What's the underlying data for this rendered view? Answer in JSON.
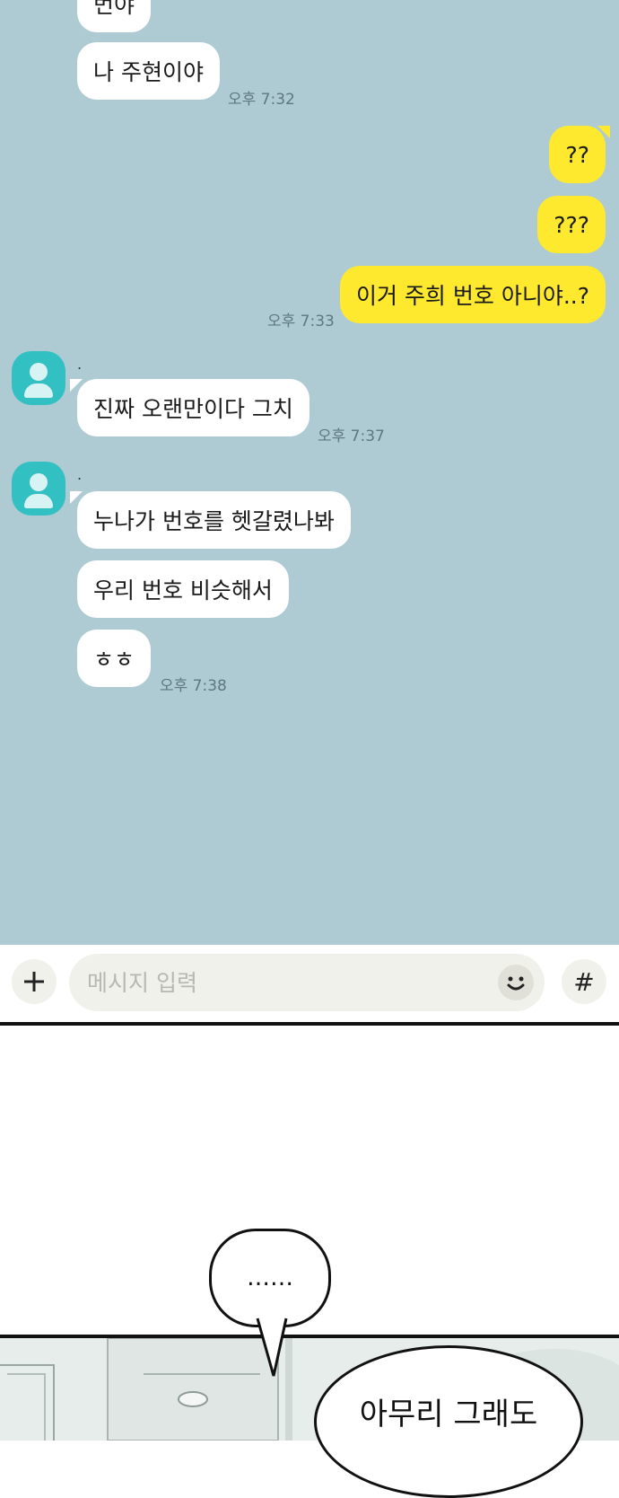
{
  "chat": {
    "messages_top": [
      {
        "text": "번야",
        "partial": true
      },
      {
        "text": "나 주현이야",
        "time": "오후 7:32"
      }
    ],
    "outgoing": [
      {
        "text": "??"
      },
      {
        "text": "???"
      },
      {
        "text": "이거 주희 번호 아니야..?",
        "time": "오후 7:33"
      }
    ],
    "group1": {
      "sender": ".",
      "text": "진짜 오랜만이다 그치",
      "time": "오후 7:37"
    },
    "group2": {
      "sender": ".",
      "messages": [
        "누나가 번호를 헷갈렸나봐",
        "우리 번호 비슷해서",
        "ㅎㅎ"
      ],
      "time": "오후 7:38"
    }
  },
  "input": {
    "placeholder": "메시지 입력",
    "hash_label": "#"
  },
  "comic": {
    "bubble1": "……",
    "bubble2": "아무리 그래도"
  },
  "colors": {
    "chat_background": "#aecbd4",
    "outgoing_bubble": "#fee92f",
    "incoming_bubble": "#ffffff",
    "avatar": "#33c0c3"
  }
}
